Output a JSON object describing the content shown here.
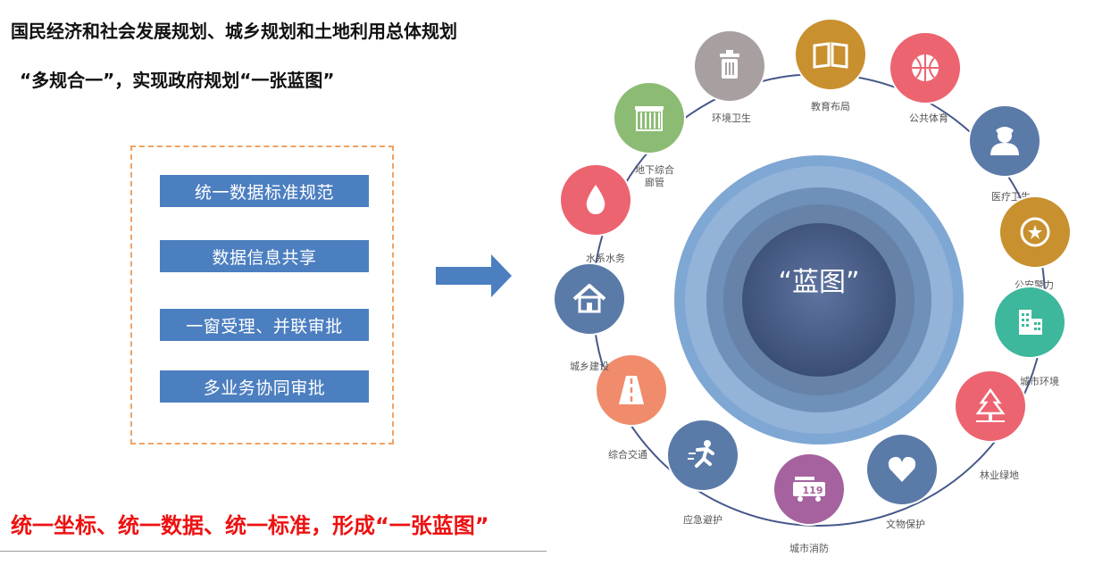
{
  "header": {
    "line1": "国民经济和社会发展规划、城乡规划和土地利用总体规划",
    "line2": "“多规合一”，实现政府规划“一张蓝图”"
  },
  "measures": [
    "统一数据标准规范",
    "数据信息共享",
    "一窗受理、并联审批",
    "多业务协同审批"
  ],
  "footer": {
    "slogan": "统一坐标、统一数据、统一标准，形成“一张蓝图”"
  },
  "wheel": {
    "center_label": "“蓝图”",
    "items": [
      {
        "label": "环境卫生",
        "label2": "",
        "color": "#a8a0a0",
        "icon": "trash-can-icon"
      },
      {
        "label": "教育布局",
        "label2": "",
        "color": "#c8902e",
        "icon": "open-book-icon"
      },
      {
        "label": "公共体育",
        "label2": "",
        "color": "#ec6470",
        "icon": "basketball-icon"
      },
      {
        "label": "医疗卫生",
        "label2": "",
        "color": "#5a7aa8",
        "icon": "doctor-icon"
      },
      {
        "label": "公安警力",
        "label2": "",
        "color": "#c8902e",
        "icon": "police-badge-icon"
      },
      {
        "label": "城市环境",
        "label2": "",
        "color": "#3db89c",
        "icon": "buildings-icon"
      },
      {
        "label": "林业绿地",
        "label2": "",
        "color": "#ec6470",
        "icon": "tree-icon"
      },
      {
        "label": "文物保护",
        "label2": "",
        "color": "#5a7aa8",
        "icon": "heart-icon"
      },
      {
        "label": "城市消防",
        "label2": "",
        "color": "#a5629e",
        "icon": "fire-truck-icon"
      },
      {
        "label": "应急避护",
        "label2": "",
        "color": "#5a7aa8",
        "icon": "running-person-icon"
      },
      {
        "label": "综合交通",
        "label2": "",
        "color": "#f08c6c",
        "icon": "road-icon"
      },
      {
        "label": "城乡建设",
        "label2": "",
        "color": "#5a7aa8",
        "icon": "house-icon"
      },
      {
        "label": "水系水务",
        "label2": "",
        "color": "#ec6470",
        "icon": "water-drop-icon"
      },
      {
        "label": "地下综合",
        "label2": "廊管",
        "color": "#8cbc74",
        "icon": "pipe-gallery-icon"
      }
    ]
  }
}
